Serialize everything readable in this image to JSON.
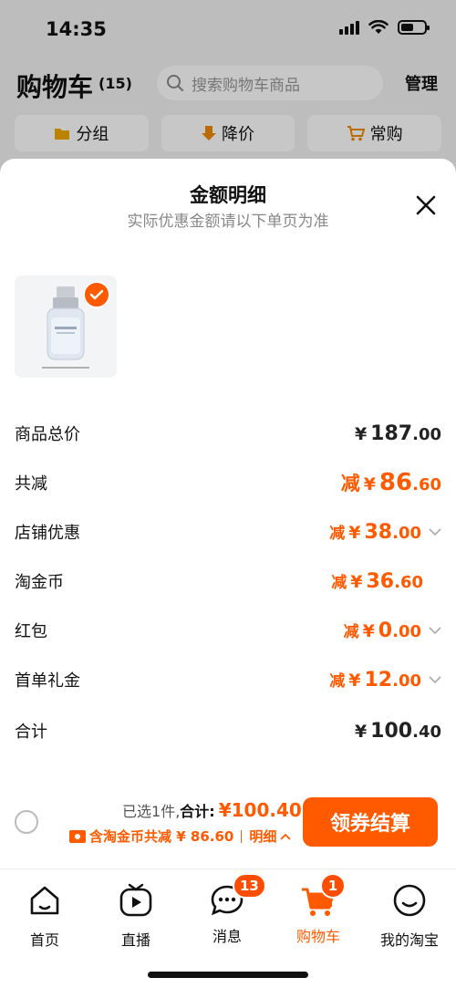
{
  "status_bar": {
    "time": "14:35"
  },
  "background": {
    "title": "购物车",
    "count": "(15)",
    "search_placeholder": "搜索购物车商品",
    "manage": "管理",
    "chips": [
      {
        "label": "分组",
        "icon": "folder-icon"
      },
      {
        "label": "降价",
        "icon": "price-drop-icon"
      },
      {
        "label": "常购",
        "icon": "cart-icon"
      }
    ]
  },
  "sheet": {
    "title": "金额明细",
    "subtitle": "实际优惠金额请以下单页为准",
    "product": {
      "brand": "Curél",
      "selected": true
    },
    "rows": [
      {
        "label": "商品总价",
        "prefix": "",
        "int": "187",
        "dec": ".00",
        "highlight": false,
        "chevron": false
      },
      {
        "label": "共减",
        "prefix": "减",
        "int": "86",
        "dec": ".60",
        "highlight": true,
        "chevron": false
      },
      {
        "label": "店铺优惠",
        "prefix": "减",
        "int": "38",
        "dec": ".00",
        "highlight": true,
        "chevron": true
      },
      {
        "label": "淘金币",
        "prefix": "减",
        "int": "36",
        "dec": ".60",
        "highlight": true,
        "chevron": false
      },
      {
        "label": "红包",
        "prefix": "减",
        "int": "0",
        "dec": ".00",
        "highlight": true,
        "chevron": true
      },
      {
        "label": "首单礼金",
        "prefix": "减",
        "int": "12",
        "dec": ".00",
        "highlight": true,
        "chevron": true
      },
      {
        "label": "合计",
        "prefix": "",
        "int": "100",
        "dec": ".40",
        "highlight": false,
        "chevron": false
      }
    ],
    "currency": "¥"
  },
  "checkout": {
    "selected_prefix": "已选",
    "selected_count": "1",
    "selected_suffix": "件,",
    "total_label": "合计:",
    "total_amount": "¥100.40",
    "discount_text": "含淘金币共减 ¥ 86.60",
    "detail_label": "明细",
    "button_label": "领券结算"
  },
  "tabs": [
    {
      "label": "首页",
      "icon": "home-icon",
      "badge": ""
    },
    {
      "label": "直播",
      "icon": "live-icon",
      "badge": ""
    },
    {
      "label": "消息",
      "icon": "message-icon",
      "badge": "13"
    },
    {
      "label": "购物车",
      "icon": "cart-icon",
      "badge": "1",
      "active": true
    },
    {
      "label": "我的淘宝",
      "icon": "profile-icon",
      "badge": ""
    }
  ],
  "colors": {
    "accent": "#ff5a00",
    "badge": "#ff4d00"
  }
}
